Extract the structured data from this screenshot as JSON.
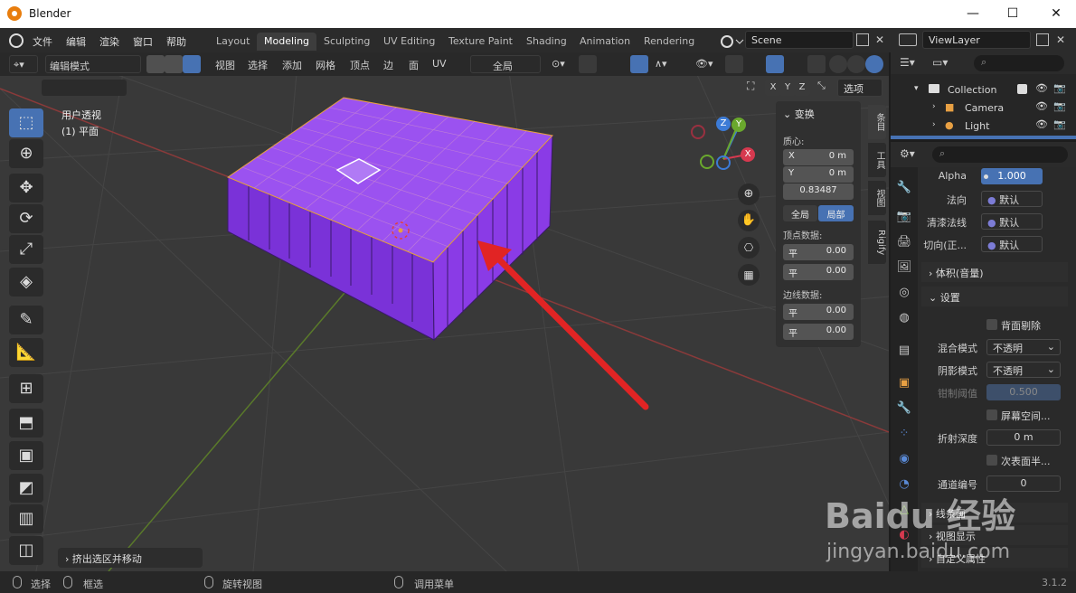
{
  "window": {
    "title": "Blender",
    "minimize": "—",
    "maximize": "☐",
    "close": "✕"
  },
  "menu": [
    "文件",
    "编辑",
    "渲染",
    "窗口",
    "帮助"
  ],
  "workspaces": [
    "Layout",
    "Modeling",
    "Sculpting",
    "UV Editing",
    "Texture Paint",
    "Shading",
    "Animation",
    "Rendering"
  ],
  "active_workspace": "Modeling",
  "scene": {
    "name": "Scene"
  },
  "view_layer": {
    "name": "ViewLayer"
  },
  "viewport_header": {
    "mode": "编辑模式",
    "menus": [
      "视图",
      "选择",
      "添加",
      "网格",
      "顶点",
      "边",
      "面",
      "UV"
    ],
    "transform_orientation": "全局",
    "axes": [
      "X",
      "Y",
      "Z"
    ],
    "options": "选项"
  },
  "viewport": {
    "view_name": "用户透视",
    "object_name": "(1) 平面",
    "last_operator": "挤出选区并移动",
    "gizmo_axes": [
      "X",
      "Y",
      "Z"
    ]
  },
  "npanel": {
    "section": "变换",
    "median_label": "质心:",
    "x_label": "X",
    "x_value": "0 m",
    "y_label": "Y",
    "y_value": "0 m",
    "z_value": "0.83487",
    "global_btn": "全局",
    "local_btn": "局部",
    "vertex_data_label": "顶点数据:",
    "vertex_row1_label": "平",
    "vertex_row1_value": "0.00",
    "vertex_row2_label": "平",
    "vertex_row2_value": "0.00",
    "edge_data_label": "边线数据:",
    "edge_row1_label": "平",
    "edge_row1_value": "0.00",
    "edge_row2_label": "平",
    "edge_row2_value": "0.00",
    "tabs": [
      "条目",
      "工具",
      "视图",
      "Rigify"
    ]
  },
  "outliner": {
    "rows": [
      {
        "label": "Collection"
      },
      {
        "label": "Camera"
      },
      {
        "label": "Light"
      }
    ]
  },
  "properties": {
    "alpha_label": "Alpha",
    "alpha_value": "1.000",
    "normal_label": "法向",
    "normal_value": "默认",
    "clearcoat_label": "清漆法线",
    "clearcoat_value": "默认",
    "tangent_label": "切向(正...",
    "tangent_value": "默认",
    "volume_section": "体积(音量)",
    "settings_section": "设置",
    "backface_label": "背面剔除",
    "blend_label": "混合模式",
    "blend_value": "不透明",
    "shadow_label": "阴影模式",
    "shadow_value": "不透明",
    "clip_label": "钳制阈值",
    "clip_value": "0.500",
    "screen_space_label": "屏幕空间...",
    "refraction_label": "折射深度",
    "refraction_value": "0 m",
    "subsurface_label": "次表面半...",
    "pass_label": "通道编号",
    "pass_value": "0",
    "lineart_section": "线条画",
    "viewport_display_section": "视图显示",
    "custom_props_section": "自定义属性"
  },
  "statusbar": {
    "select": "选择",
    "box_select": "框选",
    "rotate_view": "旋转视图",
    "call_menu": "调用菜单",
    "version": "3.1.2"
  },
  "watermark": {
    "brand": "Baidu 经验",
    "url": "jingyan.baidu.com"
  },
  "colors": {
    "accent": "#4772b3",
    "mesh": "#8a3be6",
    "arrow": "#e12424"
  }
}
